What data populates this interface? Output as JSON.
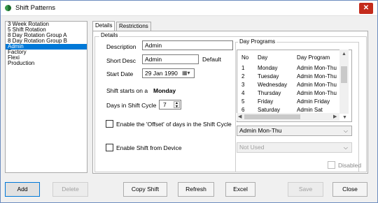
{
  "window": {
    "title": "Shift Patterns",
    "close_glyph": "✕"
  },
  "shift_list": {
    "items": [
      "3 Week Rotation",
      "5 Shift Rotation",
      "8 Day Rotation Group A",
      "8 Day Rotation Group B",
      "Admin",
      "Factory",
      "Flexi",
      "Production"
    ],
    "selected": "Admin"
  },
  "tabs": [
    "Details",
    "Restrictions"
  ],
  "details": {
    "group_label": "Details",
    "description_label": "Description",
    "description_value": "Admin",
    "short_desc_label": "Short Desc",
    "short_desc_value": "Admin",
    "default_label": "Default",
    "start_date_label": "Start Date",
    "start_date_value": "29 Jan 1990",
    "starts_on_label": "Shift starts on a",
    "starts_on_value": "Monday",
    "days_label": "Days in Shift Cycle",
    "days_value": "7",
    "offset_label": "Enable the 'Offset' of days in the Shift Cycle",
    "device_label": "Enable Shift from Device",
    "device_value": "Not Used",
    "disabled_label": "Disabled"
  },
  "day_programs": {
    "group_label": "Day Programs",
    "columns": [
      "No",
      "Day",
      "Day Program"
    ],
    "rows": [
      [
        "1",
        "Monday",
        "Admin Mon-Thu"
      ],
      [
        "2",
        "Tuesday",
        "Admin Mon-Thu"
      ],
      [
        "3",
        "Wednesday",
        "Admin Mon-Thu"
      ],
      [
        "4",
        "Thursday",
        "Admin Mon-Thu"
      ],
      [
        "5",
        "Friday",
        "Admin Friday"
      ],
      [
        "6",
        "Saturday",
        "Admin Sat"
      ]
    ],
    "selected_program": "Admin Mon-Thu"
  },
  "buttons": {
    "add": "Add",
    "delete": "Delete",
    "copy": "Copy Shift",
    "refresh": "Refresh",
    "excel": "Excel",
    "save": "Save",
    "close": "Close"
  },
  "colors": {
    "selection": "#0078d7",
    "close_red": "#c42b1c",
    "accent_border": "#0078d7"
  },
  "icons": {
    "app": "shift-patterns-app-icon",
    "calendar": "calendar-icon"
  }
}
